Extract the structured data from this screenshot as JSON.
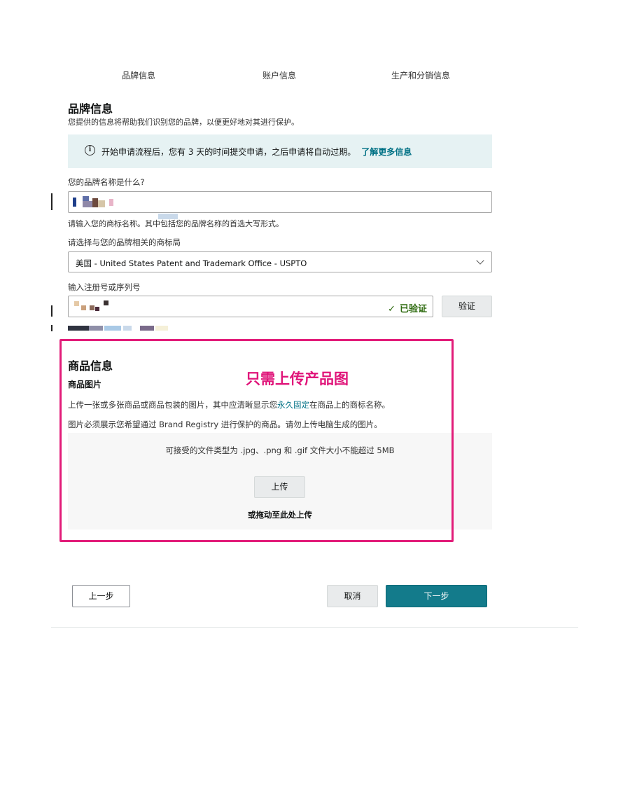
{
  "steps": [
    "品牌信息",
    "账户信息",
    "生产和分销信息"
  ],
  "brand_section": {
    "title": "品牌信息",
    "subtitle": "您提供的信息将帮助我们识别您的品牌，以便更好地对其进行保护。",
    "info_text": "开始申请流程后，您有 3 天的时间提交申请，之后申请将自动过期。",
    "info_link": "了解更多信息"
  },
  "brand_name": {
    "label": "您的品牌名称是什么?",
    "hint": "请输入您的商标名称。其中包括您的品牌名称的首选大写形式。"
  },
  "trademark_office": {
    "label": "请选择与您的品牌相关的商标局",
    "selected": "美国 - United States Patent and Trademark Office - USPTO"
  },
  "registration": {
    "label": "输入注册号或序列号",
    "verified_text": "已验证",
    "verify_button": "验证"
  },
  "product_section": {
    "title": "商品信息",
    "subtitle": "商品图片",
    "desc1_pre": "上传一张或多张商品或商品包装的图片，其中应清晰显示您",
    "desc1_link": "永久固定",
    "desc1_post": "在商品上的商标名称。",
    "desc2": "图片必须展示您希望通过 Brand Registry 进行保护的商品。请勿上传电脑生成的图片。",
    "file_types": "可接受的文件类型为 .jpg、.png 和 .gif    文件大小不能超过 5MB",
    "upload_button": "上传",
    "drag_text": "或拖动至此处上传"
  },
  "annotation": "只需上传产品图",
  "footer": {
    "prev": "上一步",
    "cancel": "取消",
    "next": "下一步"
  },
  "colors": {
    "accent_teal": "#137b8b",
    "link": "#007185",
    "verified_green": "#2d6a0e",
    "highlight_pink": "#e21c79",
    "info_bg": "#e6f2f3"
  }
}
